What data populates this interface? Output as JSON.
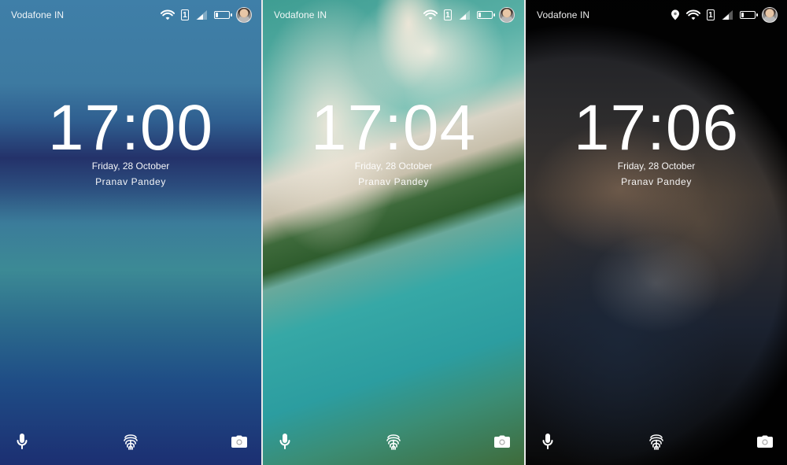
{
  "screens": [
    {
      "carrier": "Vodafone IN",
      "sim_slot": "1",
      "time": "17:00",
      "date": "Friday, 28 October",
      "owner": "Pranav Pandey",
      "battery_level": 0.2,
      "location_icon": false
    },
    {
      "carrier": "Vodafone IN",
      "sim_slot": "1",
      "time": "17:04",
      "date": "Friday, 28 October",
      "owner": "Pranav Pandey",
      "battery_level": 0.2,
      "location_icon": false
    },
    {
      "carrier": "Vodafone IN",
      "sim_slot": "1",
      "time": "17:06",
      "date": "Friday, 28 October",
      "owner": "Pranav Pandey",
      "battery_level": 0.2,
      "location_icon": true
    }
  ],
  "icons": {
    "wifi": "wifi-icon",
    "signal": "signal-icon",
    "battery": "battery-icon",
    "location": "location-pin-icon",
    "mic": "microphone-icon",
    "fingerprint": "fingerprint-icon",
    "camera": "camera-icon"
  },
  "colors": {
    "text": "#ffffff"
  }
}
